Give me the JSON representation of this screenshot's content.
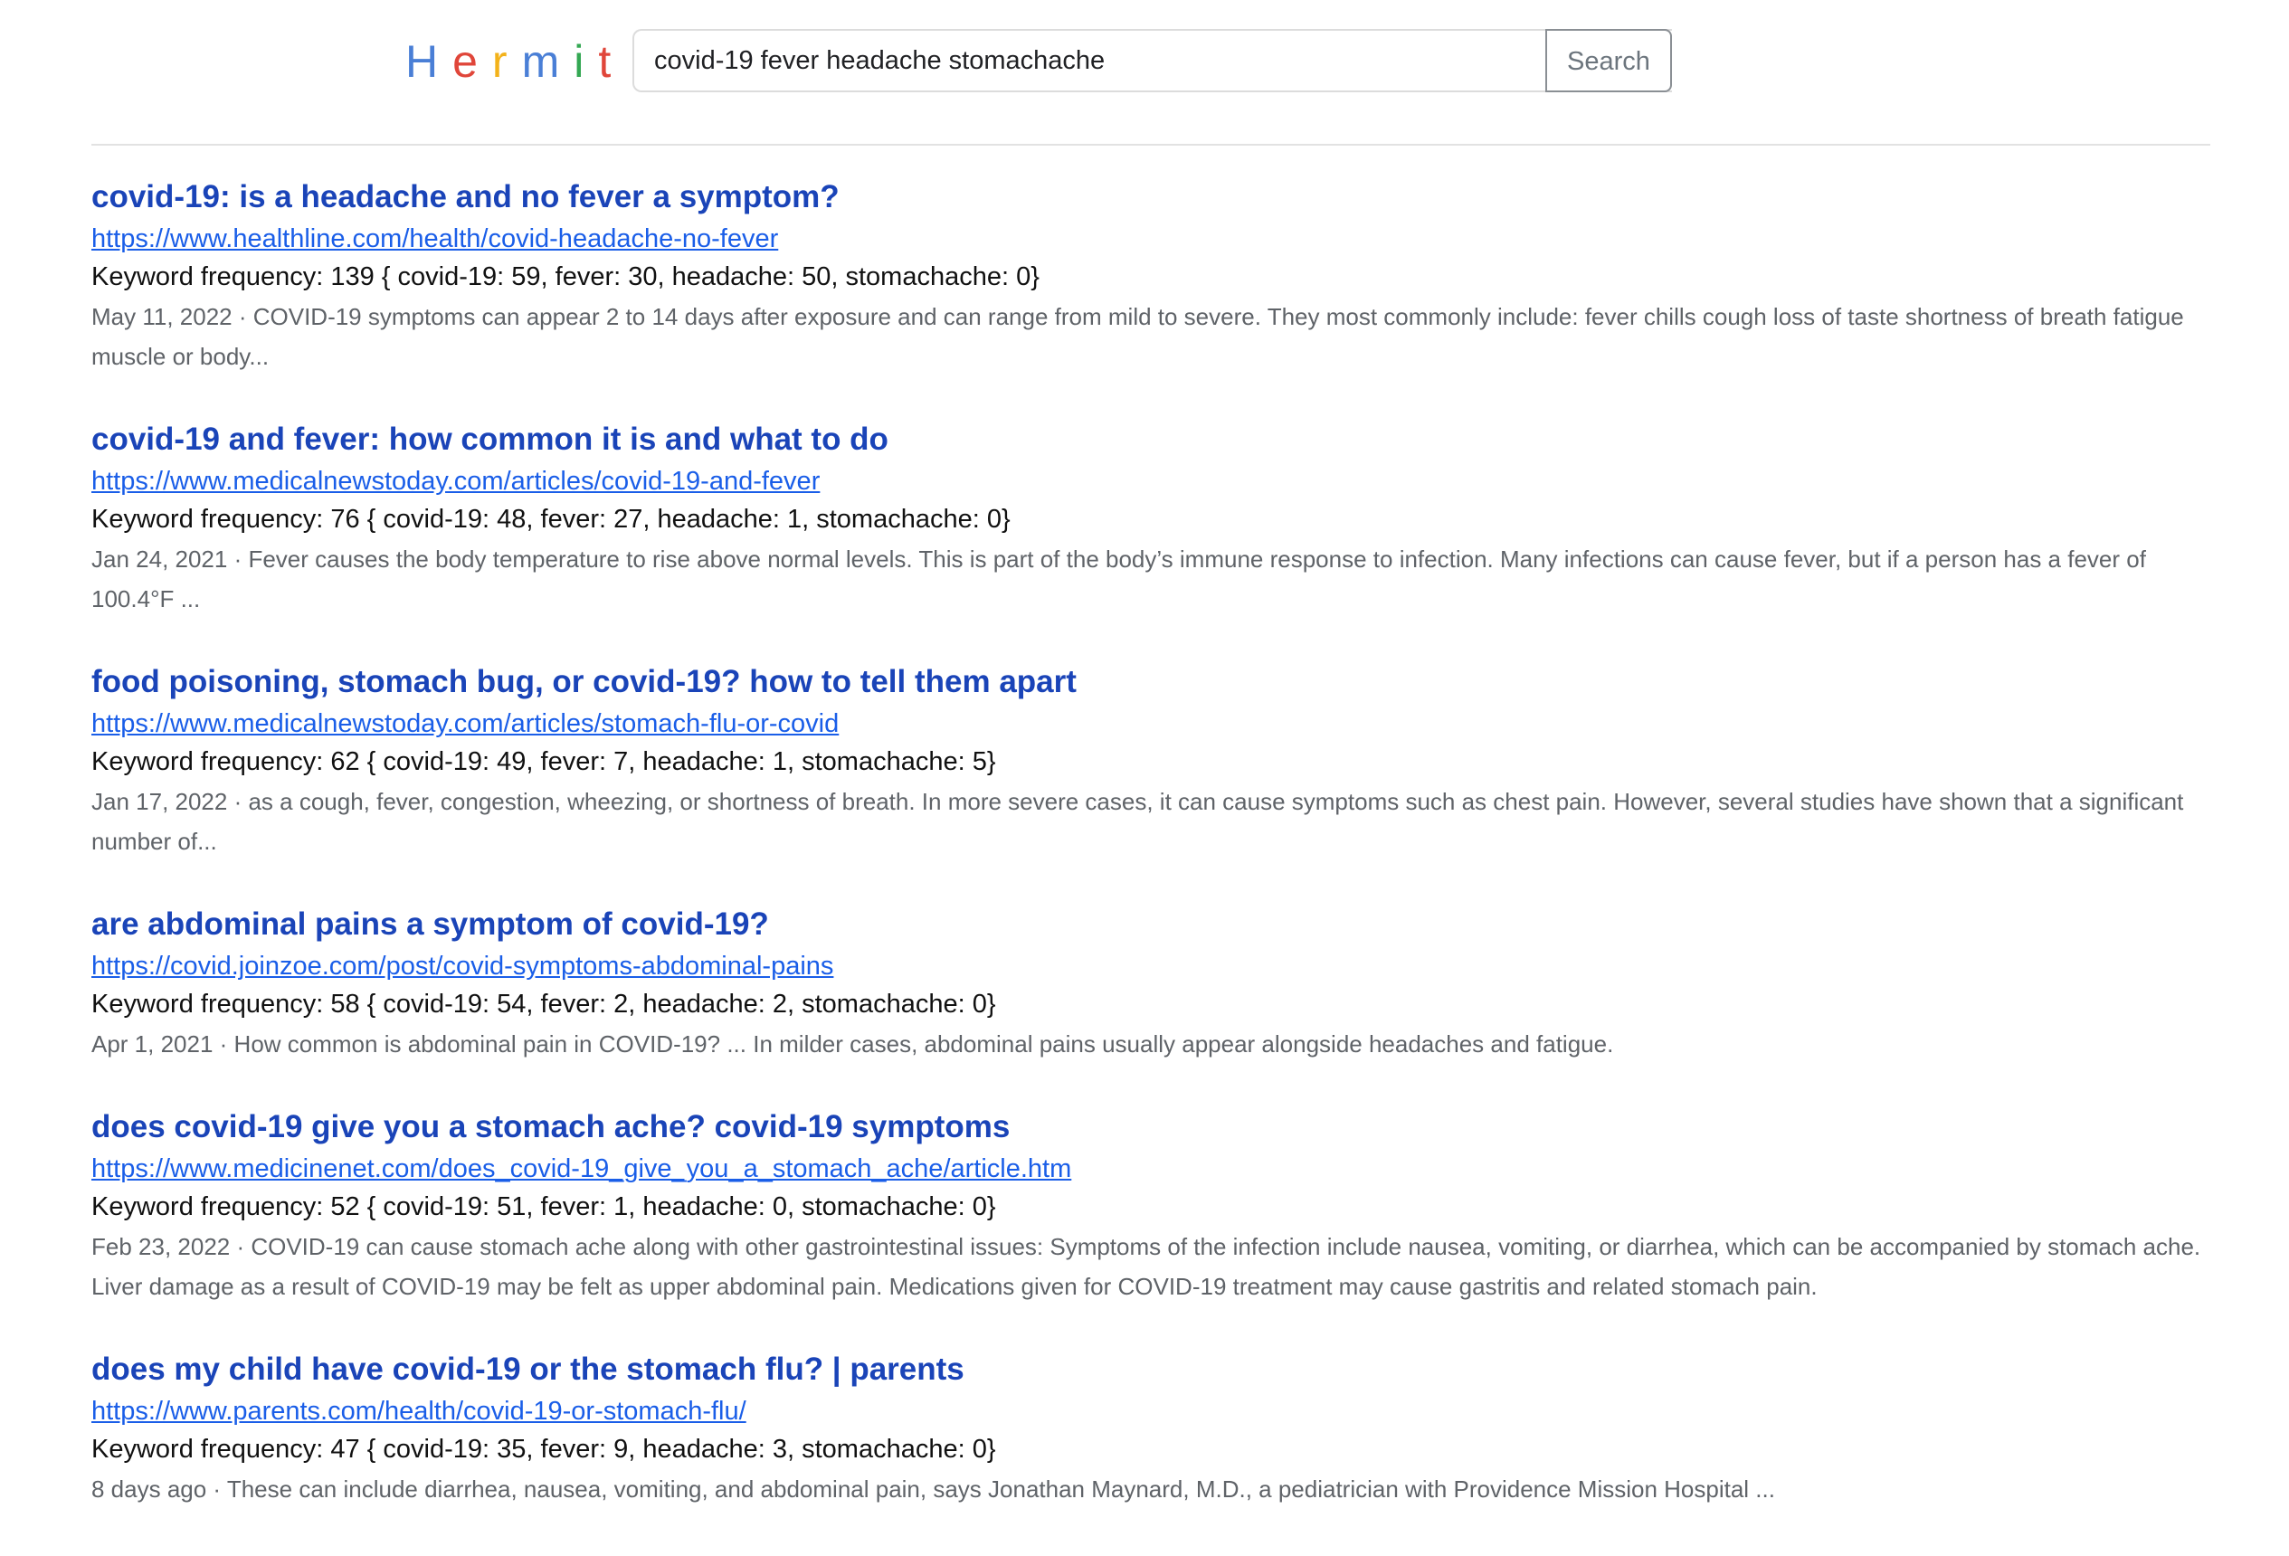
{
  "header": {
    "logo_letters": [
      {
        "char": "H",
        "color": "#4a7fd6"
      },
      {
        "char": "e",
        "color": "#e0463a"
      },
      {
        "char": "r",
        "color": "#f3b21a"
      },
      {
        "char": "m",
        "color": "#4a7fd6"
      },
      {
        "char": "i",
        "color": "#34a853"
      },
      {
        "char": "t",
        "color": "#e0463a"
      }
    ],
    "search_value": "covid-19 fever headache stomachache",
    "search_button_label": "Search"
  },
  "results": [
    {
      "title": "covid-19: is a headache and no fever a symptom?",
      "url": "https://www.healthline.com/health/covid-headache-no-fever",
      "frequency": "Keyword frequency: 139 { covid-19: 59, fever: 30, headache: 50, stomachache: 0}",
      "snippet": "May 11, 2022 · COVID-19 symptoms can appear 2 to 14 days after exposure and can range from mild to severe. They most commonly include: fever chills cough loss of taste shortness of breath fatigue muscle or body..."
    },
    {
      "title": "covid-19 and fever: how common it is and what to do",
      "url": "https://www.medicalnewstoday.com/articles/covid-19-and-fever",
      "frequency": "Keyword frequency: 76 { covid-19: 48, fever: 27, headache: 1, stomachache: 0}",
      "snippet": "Jan 24, 2021 · Fever causes the body temperature to rise above normal levels. This is part of the body’s immune response to infection. Many infections can cause fever, but if a person has a fever of 100.4°F ..."
    },
    {
      "title": "food poisoning, stomach bug, or covid-19? how to tell them apart",
      "url": "https://www.medicalnewstoday.com/articles/stomach-flu-or-covid",
      "frequency": "Keyword frequency: 62 { covid-19: 49, fever: 7, headache: 1, stomachache: 5}",
      "snippet": "Jan 17, 2022 · as a cough, fever, congestion, wheezing, or shortness of breath. In more severe cases, it can cause symptoms such as chest pain. However, several studies have shown that a significant number of..."
    },
    {
      "title": "are abdominal pains a symptom of covid-19?",
      "url": "https://covid.joinzoe.com/post/covid-symptoms-abdominal-pains",
      "frequency": "Keyword frequency: 58 { covid-19: 54, fever: 2, headache: 2, stomachache: 0}",
      "snippet": "Apr 1, 2021 · How common is abdominal pain in COVID-19? ... In milder cases, abdominal pains usually appear alongside headaches and fatigue."
    },
    {
      "title": "does covid-19 give you a stomach ache? covid-19 symptoms",
      "url": "https://www.medicinenet.com/does_covid-19_give_you_a_stomach_ache/article.htm",
      "frequency": "Keyword frequency: 52 { covid-19: 51, fever: 1, headache: 0, stomachache: 0}",
      "snippet": "Feb 23, 2022 · COVID-19 can cause stomach ache along with other gastrointestinal issues: Symptoms of the infection include nausea, vomiting, or diarrhea, which can be accompanied by stomach ache. Liver damage as a result of COVID-19 may be felt as upper abdominal pain. Medications given for COVID-19 treatment may cause gastritis and related stomach pain."
    },
    {
      "title": "does my child have covid-19 or the stomach flu? | parents",
      "url": "https://www.parents.com/health/covid-19-or-stomach-flu/",
      "frequency": "Keyword frequency: 47 { covid-19: 35, fever: 9, headache: 3, stomachache: 0}",
      "snippet": "8 days ago · These can include diarrhea, nausea, vomiting, and abdominal pain, says Jonathan Maynard, M.D., a pediatrician with Providence Mission Hospital ..."
    }
  ]
}
